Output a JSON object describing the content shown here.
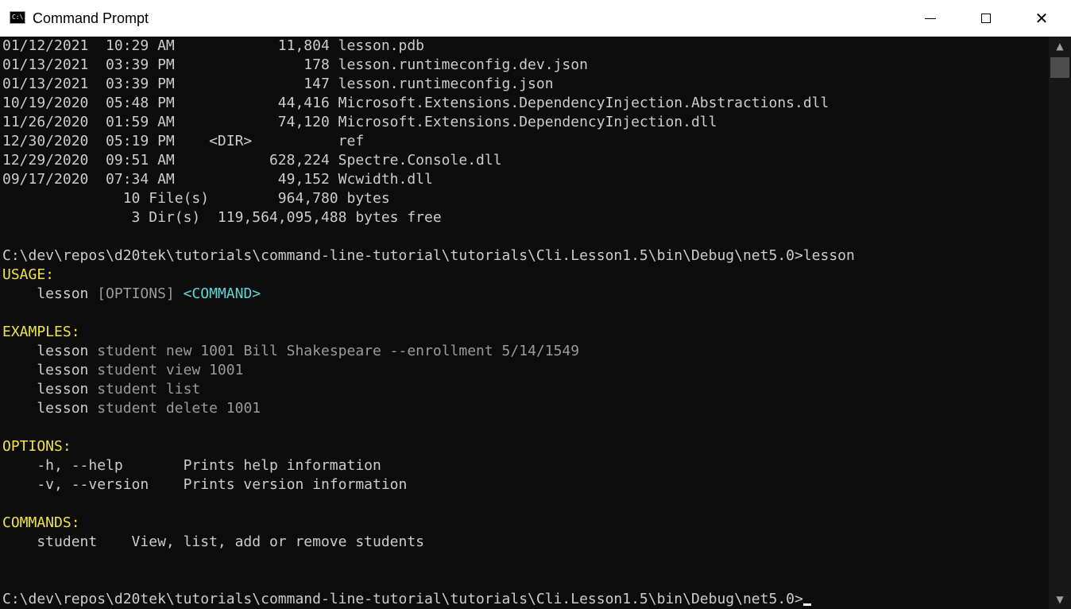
{
  "window": {
    "title": "Command Prompt",
    "icon_text": "C:\\.",
    "minimize_icon": "minimize-icon",
    "maximize_icon": "maximize-icon",
    "close_icon": "close-icon",
    "close_glyph": "✕"
  },
  "console": {
    "dir_lines": [
      "01/12/2021  10:29 AM            11,804 lesson.pdb",
      "01/13/2021  03:39 PM               178 lesson.runtimeconfig.dev.json",
      "01/13/2021  03:39 PM               147 lesson.runtimeconfig.json",
      "10/19/2020  05:48 PM            44,416 Microsoft.Extensions.DependencyInjection.Abstractions.dll",
      "11/26/2020  01:59 AM            74,120 Microsoft.Extensions.DependencyInjection.dll",
      "12/30/2020  05:19 PM    <DIR>          ref",
      "12/29/2020  09:51 AM           628,224 Spectre.Console.dll",
      "09/17/2020  07:34 AM            49,152 Wcwidth.dll",
      "              10 File(s)        964,780 bytes",
      "               3 Dir(s)  119,564,095,488 bytes free"
    ],
    "prompt_command": "C:\\dev\\repos\\d20tek\\tutorials\\command-line-tutorial\\tutorials\\Cli.Lesson1.5\\bin\\Debug\\net5.0>lesson",
    "usage": {
      "heading": "USAGE:",
      "cmd": "    lesson ",
      "options": "[OPTIONS] ",
      "command": "<COMMAND>"
    },
    "examples": {
      "heading": "EXAMPLES:",
      "items": [
        {
          "cmd": "    lesson ",
          "args": "student new 1001 Bill Shakespeare --enrollment 5/14/1549"
        },
        {
          "cmd": "    lesson ",
          "args": "student view 1001"
        },
        {
          "cmd": "    lesson ",
          "args": "student list"
        },
        {
          "cmd": "    lesson ",
          "args": "student delete 1001"
        }
      ]
    },
    "options": {
      "heading": "OPTIONS:",
      "items": [
        "    -h, --help       Prints help information",
        "    -v, --version    Prints version information"
      ]
    },
    "commands": {
      "heading": "COMMANDS:",
      "items": [
        "    student    View, list, add or remove students"
      ]
    },
    "final_prompt": "C:\\dev\\repos\\d20tek\\tutorials\\command-line-tutorial\\tutorials\\Cli.Lesson1.5\\bin\\Debug\\net5.0>"
  },
  "scrollbar": {
    "up_glyph": "▲",
    "down_glyph": "▼",
    "up_icon": "scroll-up-arrow-icon",
    "down_icon": "scroll-down-arrow-icon"
  },
  "colors": {
    "background": "#0c0c0c",
    "text": "#cccccc",
    "heading_yellow": "#f0e442",
    "accent_cyan": "#61d6d6",
    "dim_gray": "#9a9a9a"
  }
}
